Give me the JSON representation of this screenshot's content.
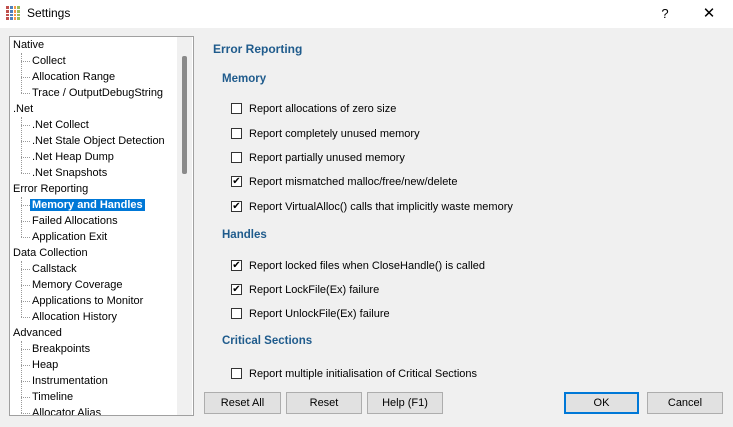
{
  "window": {
    "title": "Settings",
    "help_label": "?",
    "close_label": "✕"
  },
  "tree": [
    {
      "label": "Native",
      "children": [
        "Collect",
        "Allocation Range",
        "Trace / OutputDebugString"
      ]
    },
    {
      "label": ".Net",
      "children": [
        ".Net Collect",
        ".Net Stale Object Detection",
        ".Net Heap Dump",
        ".Net Snapshots"
      ]
    },
    {
      "label": "Error Reporting",
      "children": [
        "Memory and Handles",
        "Failed Allocations",
        "Application Exit"
      ]
    },
    {
      "label": "Data Collection",
      "children": [
        "Callstack",
        "Memory Coverage",
        "Applications to Monitor",
        "Allocation History"
      ]
    },
    {
      "label": "Advanced",
      "children": [
        "Breakpoints",
        "Heap",
        "Instrumentation",
        "Timeline",
        "Allocator Alias"
      ]
    }
  ],
  "selected_item": "Memory and Handles",
  "panel": {
    "title": "Error Reporting",
    "sections": [
      {
        "heading": "Memory",
        "options": [
          {
            "label": "Report allocations of zero size",
            "checked": false
          },
          {
            "label": "Report completely unused memory",
            "checked": false
          },
          {
            "label": "Report partially unused memory",
            "checked": false
          },
          {
            "label": "Report mismatched malloc/free/new/delete",
            "checked": true
          },
          {
            "label": "Report VirtualAlloc() calls that implicitly waste memory",
            "checked": true
          }
        ]
      },
      {
        "heading": "Handles",
        "options": [
          {
            "label": "Report locked files when CloseHandle() is called",
            "checked": true
          },
          {
            "label": "Report LockFile(Ex) failure",
            "checked": true
          },
          {
            "label": "Report UnlockFile(Ex) failure",
            "checked": false
          }
        ]
      },
      {
        "heading": "Critical Sections",
        "options": [
          {
            "label": "Report multiple initialisation of Critical Sections",
            "checked": false
          }
        ]
      }
    ]
  },
  "buttons": {
    "reset_all": "Reset All",
    "reset": "Reset",
    "help": "Help (F1)",
    "ok": "OK",
    "cancel": "Cancel"
  }
}
